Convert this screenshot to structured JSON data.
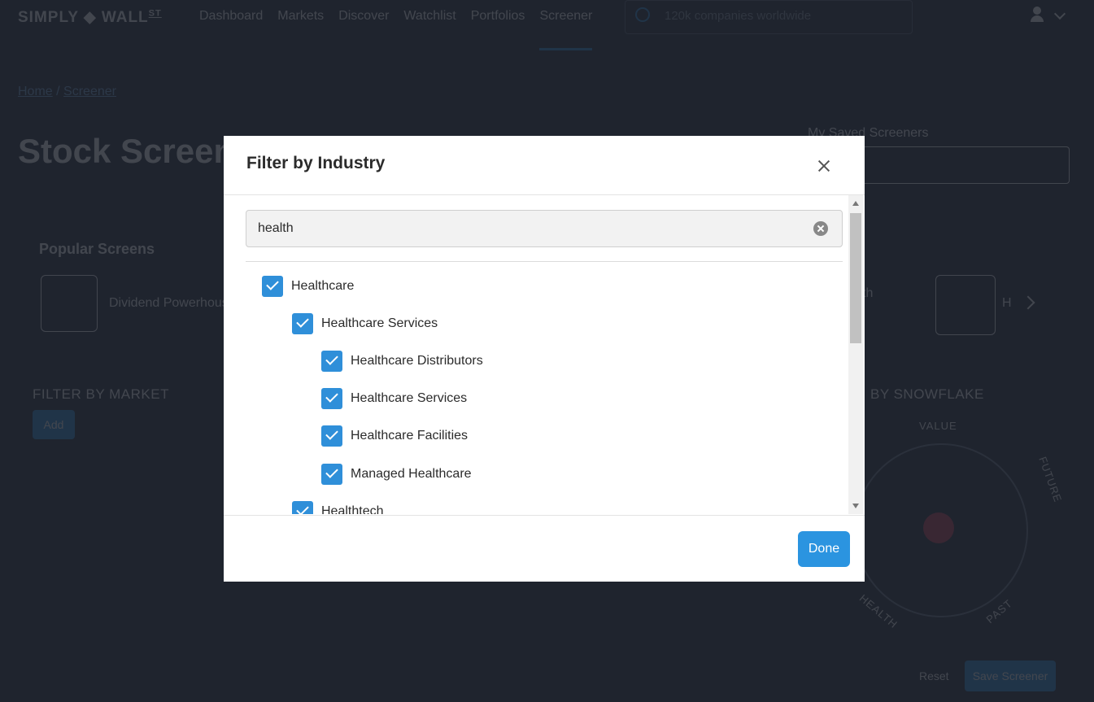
{
  "nav": {
    "logo_left": "SIMPLY",
    "logo_right": "WALL",
    "logo_suffix": "ST",
    "items": [
      {
        "label": "Dashboard"
      },
      {
        "label": "Markets"
      },
      {
        "label": "Discover"
      },
      {
        "label": "Watchlist"
      },
      {
        "label": "Portfolios"
      },
      {
        "label": "Screener"
      }
    ],
    "active_index": 5,
    "search_placeholder": "120k companies worldwide"
  },
  "page": {
    "breadcrumb": [
      {
        "label": "Home"
      },
      {
        "label": "Screener"
      }
    ],
    "breadcrumb_sep": "/",
    "title": "Stock Screener",
    "saved_screeners_label": "My Saved Screeners",
    "popular_title": "Popular Screens",
    "popular_card": "Dividend Powerhous",
    "partial_card_1": "th",
    "partial_card_2": "H",
    "filter_market_label": "FILTER BY MARKET",
    "add_label": "Add",
    "filter_snowflake_label": "BY SNOWFLAKE",
    "snowflake_axes": {
      "value": "VALUE",
      "future": "FUTURE",
      "health": "HEALTH",
      "past": "PAST"
    },
    "reset_label": "Reset",
    "save_label": "Save Screener"
  },
  "modal": {
    "title": "Filter by Industry",
    "search_value": "health",
    "done_label": "Done",
    "items": [
      {
        "label": "Healthcare",
        "level": 0,
        "checked": true
      },
      {
        "label": "Healthcare Services",
        "level": 1,
        "checked": true
      },
      {
        "label": "Healthcare Distributors",
        "level": 2,
        "checked": true
      },
      {
        "label": "Healthcare Services",
        "level": 2,
        "checked": true
      },
      {
        "label": "Healthcare Facilities",
        "level": 2,
        "checked": true
      },
      {
        "label": "Managed Healthcare",
        "level": 2,
        "checked": true
      },
      {
        "label": "Healthtech",
        "level": 1,
        "checked": true
      }
    ]
  },
  "colors": {
    "page_bg": "#262c37",
    "accent": "#2f8fd9",
    "modal_bg": "#ffffff"
  }
}
